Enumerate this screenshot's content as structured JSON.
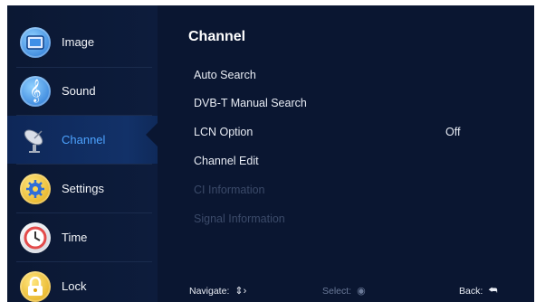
{
  "sidebar": {
    "items": [
      {
        "label": "Image",
        "icon": "image-icon",
        "color": "#5fb0ff"
      },
      {
        "label": "Sound",
        "icon": "sound-icon",
        "color": "#5fb0ff"
      },
      {
        "label": "Channel",
        "icon": "satellite-dish-icon",
        "color": "#cfd6e4",
        "active": true
      },
      {
        "label": "Settings",
        "icon": "gear-icon",
        "color": "#f1c21b"
      },
      {
        "label": "Time",
        "icon": "clock-icon",
        "color": "#e34b4b"
      },
      {
        "label": "Lock",
        "icon": "lock-icon",
        "color": "#f1c21b"
      }
    ]
  },
  "main": {
    "title": "Channel",
    "items": [
      {
        "label": "Auto Search"
      },
      {
        "label": "DVB-T Manual Search"
      },
      {
        "label": "LCN Option",
        "value": "Off"
      },
      {
        "label": "Channel Edit"
      },
      {
        "label": "CI Information",
        "disabled": true
      },
      {
        "label": "Signal Information",
        "disabled": true
      }
    ]
  },
  "footer": {
    "navigate": "Navigate:",
    "select": "Select:",
    "back": "Back:"
  },
  "colors": {
    "accent": "#4da3ff",
    "background": "#07122b"
  }
}
